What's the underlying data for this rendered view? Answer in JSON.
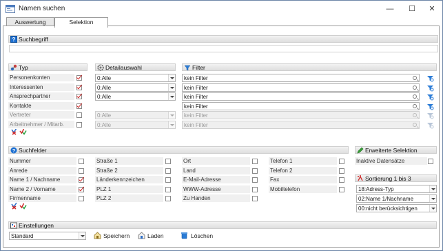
{
  "window": {
    "title": "Namen suchen",
    "minimize": "—",
    "maximize": "☐",
    "close": "✕"
  },
  "tabs": [
    {
      "label": "Auswertung"
    },
    {
      "label": "Selektion"
    }
  ],
  "sections": {
    "suchbegriff": "Suchbegriff",
    "typ": "Typ",
    "detailauswahl": "Detailauswahl",
    "filter": "Filter",
    "suchfelder": "Suchfelder",
    "erweiterte": "Erweiterte Selektion",
    "sortierung": "Sortierung 1 bis 3",
    "einstellungen": "Einstellungen"
  },
  "typ_rows": [
    {
      "label": "Personenkonten",
      "checked": true,
      "detail": "0:Alle",
      "filter": "kein Filter",
      "enabled": true
    },
    {
      "label": "Interessenten",
      "checked": true,
      "detail": "0:Alle",
      "filter": "kein Filter",
      "enabled": true
    },
    {
      "label": "Ansprechpartner",
      "checked": true,
      "detail": "0:Alle",
      "filter": "kein Filter",
      "enabled": true
    },
    {
      "label": "Kontakte",
      "checked": true,
      "detail": "",
      "filter": "kein Filter",
      "enabled": true
    },
    {
      "label": "Vertreter",
      "checked": false,
      "detail": "0:Alle",
      "filter": "kein Filter",
      "enabled": false
    },
    {
      "label": "Arbeitnehmer / Mitarb.",
      "checked": false,
      "detail": "0:Alle",
      "filter": "kein Filter",
      "enabled": false
    }
  ],
  "suchfelder": [
    [
      {
        "label": "Nummer",
        "checked": false
      },
      {
        "label": "Anrede",
        "checked": false
      },
      {
        "label": "Name 1 / Nachname",
        "checked": true
      },
      {
        "label": "Name 2 / Vorname",
        "checked": true
      },
      {
        "label": "Firmenname",
        "checked": false
      }
    ],
    [
      {
        "label": "Straße 1",
        "checked": false
      },
      {
        "label": "Straße 2",
        "checked": false
      },
      {
        "label": "Länderkennzeichen",
        "checked": false
      },
      {
        "label": "PLZ 1",
        "checked": false
      },
      {
        "label": "PLZ 2",
        "checked": false
      }
    ],
    [
      {
        "label": "Ort",
        "checked": false
      },
      {
        "label": "Land",
        "checked": false
      },
      {
        "label": "E-Mail-Adresse",
        "checked": false
      },
      {
        "label": "WWW-Adresse",
        "checked": false
      },
      {
        "label": "Zu Handen",
        "checked": false
      }
    ],
    [
      {
        "label": "Telefon 1",
        "checked": false
      },
      {
        "label": "Telefon 2",
        "checked": false
      },
      {
        "label": "Fax",
        "checked": false
      },
      {
        "label": "Mobiltelefon",
        "checked": false
      }
    ]
  ],
  "erweiterte": {
    "label": "Inaktive Datensätze",
    "checked": false
  },
  "sortierung": [
    "18:Adress-Typ",
    "02:Name 1/Nachname",
    "00:nicht berücksichtigen"
  ],
  "einstellungen": {
    "value": "Standard",
    "save": "Speichern",
    "load": "Laden",
    "delete": "Löschen"
  },
  "colors": {
    "accent_blue": "#1c6fd1",
    "check_red": "#cc2222",
    "header_bg": "#e6e6e6"
  }
}
